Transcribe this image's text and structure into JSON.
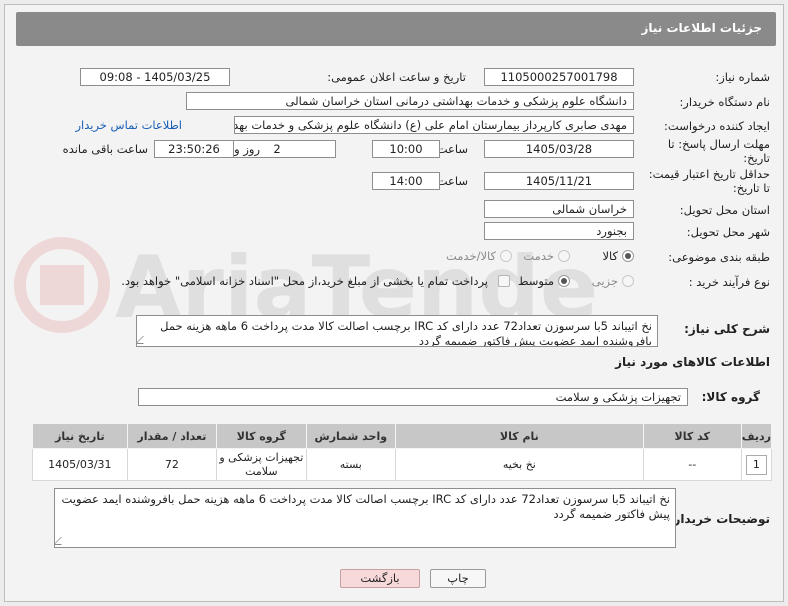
{
  "header": {
    "title": "جزئیات اطلاعات نیاز"
  },
  "fields": {
    "need_number_label": "شماره نیاز:",
    "need_number": "1105000257001798",
    "announce_label": "تاریخ و ساعت اعلان عمومی:",
    "announce_value": "1405/03/25 - 09:08",
    "buyer_org_label": "نام دستگاه خریدار:",
    "buyer_org": "دانشگاه علوم پزشکی و خدمات بهداشتی درمانی استان خراسان شمالی",
    "requester_label": "ایجاد کننده درخواست:",
    "requester": "مهدی صابری کارپرداز بیمارستان امام علی (ع) دانشگاه علوم پزشکی و خدمات بهداشتی درمانی",
    "contact_link": "اطلاعات تماس خریدار",
    "deadline_label": "مهلت ارسال پاسخ: تا تاریخ:",
    "deadline_date": "1405/03/28",
    "time_label": "ساعت",
    "deadline_time": "10:00",
    "days_value": "2",
    "days_label": "روز و",
    "remaining_time": "23:50:26",
    "remaining_label": "ساعت باقی مانده",
    "price_validity_label": "حداقل تاریخ اعتبار قیمت: تا تاریخ:",
    "price_validity_date": "1405/11/21",
    "price_validity_time": "14:00",
    "province_label": "استان محل تحویل:",
    "province": "خراسان شمالی",
    "city_label": "شهر محل تحویل:",
    "city": "بجنورد",
    "category_label": "طبقه بندی موضوعی:",
    "category_options": [
      "کالا",
      "خدمت",
      "کالا/خدمت"
    ],
    "process_label": "نوع فرآیند خرید :",
    "process_options": [
      "جزیی",
      "متوسط"
    ],
    "payment_note": "پرداخت تمام یا بخشی از مبلغ خرید،از محل \"اسناد خزانه اسلامی\" خواهد بود.",
    "description_label": "شرح کلی نیاز:",
    "description": "نخ اتیباند 5با سرسوزن تعداد72 عدد  دارای کد IRC برچسب اصالت کالا مدت پرداخت 6 ماهه هزینه حمل بافروشنده ایمد عضویت پیش فاکتور ضمیمه گردد",
    "items_title": "اطلاعات کالاهای مورد نیاز",
    "goods_group_label": "گروه کالا:",
    "goods_group": "تجهیزات پزشکی و سلامت",
    "buyer_notes_label": "توضیحات خریدار:",
    "buyer_notes": "نخ اتیباند 5با سرسوزن تعداد72 عدد  دارای کد IRC برچسب اصالت کالا مدت پرداخت 6 ماهه هزینه حمل بافروشنده ایمد عضویت پیش فاکتور ضمیمه گردد"
  },
  "table": {
    "headers": [
      "ردیف",
      "کد کالا",
      "نام کالا",
      "واحد شمارش",
      "گروه کالا",
      "تعداد / مقدار",
      "تاریخ نیاز"
    ],
    "rows": [
      [
        "1",
        "--",
        "نخ بخیه",
        "بسته",
        "تجهیزات پزشکی و سلامت",
        "72",
        "1405/03/31"
      ]
    ]
  },
  "buttons": {
    "print": "چاپ",
    "back": "بازگشت"
  },
  "watermark": "AriaTender.net",
  "colors": {
    "header_bg": "#8a8a8a",
    "link": "#1a5fb4",
    "back_bg": "#f7d9d9"
  }
}
